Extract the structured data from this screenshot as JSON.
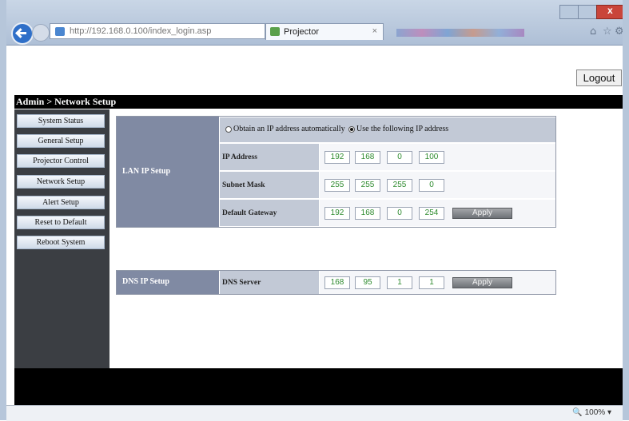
{
  "browser": {
    "address_url": "http://192.168.0.100/index_login.asp",
    "search_controls": "⌕ ▾ ↻",
    "tab_title": "Projector",
    "tab_close": "×",
    "home_icon": "home-icon",
    "favorites_icon": "star-icon",
    "tools_icon": "gear-icon"
  },
  "page": {
    "logout_label": "Logout",
    "title": "Admin > Network Setup"
  },
  "sidebar": {
    "items": [
      {
        "label": "System Status"
      },
      {
        "label": "General Setup"
      },
      {
        "label": "Projector Control"
      },
      {
        "label": "Network Setup"
      },
      {
        "label": "Alert Setup"
      },
      {
        "label": "Reset to Default"
      },
      {
        "label": "Reboot System"
      }
    ]
  },
  "lan": {
    "section_label": "LAN IP Setup",
    "option_auto": "Obtain an IP address automatically",
    "option_manual": "Use the following IP address",
    "selected_option": "manual",
    "ip_address": {
      "label": "IP Address",
      "octets": [
        "192",
        "168",
        "0",
        "100"
      ]
    },
    "subnet_mask": {
      "label": "Subnet Mask",
      "octets": [
        "255",
        "255",
        "255",
        "0"
      ]
    },
    "default_gateway": {
      "label": "Default Gateway",
      "octets": [
        "192",
        "168",
        "0",
        "254"
      ]
    },
    "apply_label": "Apply"
  },
  "dns": {
    "section_label": "DNS IP Setup",
    "server": {
      "label": "DNS Server",
      "octets": [
        "168",
        "95",
        "1",
        "1"
      ]
    },
    "apply_label": "Apply"
  },
  "status": {
    "zoom": "100%"
  },
  "colors": {
    "sidebar_bg": "#3b3e43",
    "section_label_bg": "#808aa3",
    "row_bg": "#c2c9d6",
    "octet_text": "#2e8b2e",
    "title_bar_bg": "#000000"
  }
}
